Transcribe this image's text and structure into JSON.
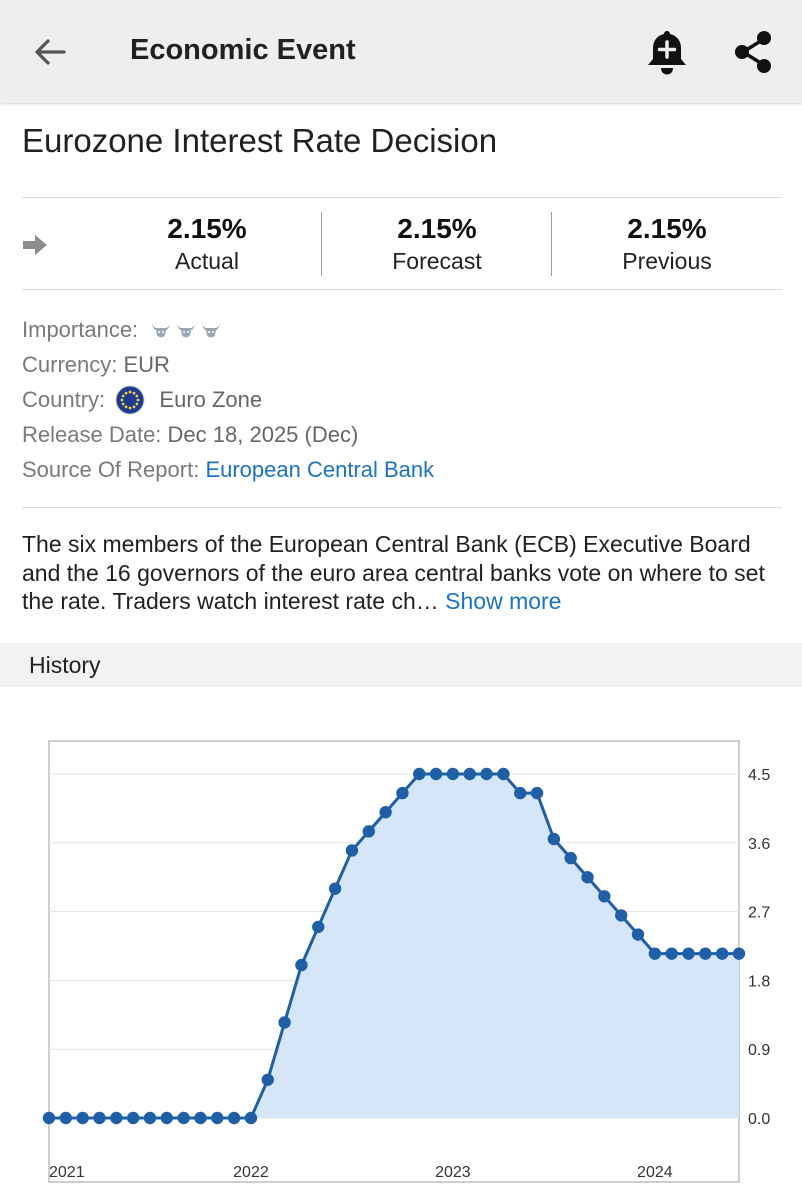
{
  "appbar": {
    "title": "Economic Event",
    "icons": [
      "arrow-back-icon",
      "bell-plus-icon",
      "share-icon"
    ]
  },
  "event": {
    "title": "Eurozone Interest Rate Decision"
  },
  "values": {
    "actual": {
      "value": "2.15%",
      "label": "Actual"
    },
    "forecast": {
      "value": "2.15%",
      "label": "Forecast"
    },
    "previous": {
      "value": "2.15%",
      "label": "Previous"
    }
  },
  "info": {
    "importance_label": "Importance:",
    "importance_level": 3,
    "currency_label": "Currency:",
    "currency_value": "EUR",
    "country_label": "Country:",
    "country_value": "Euro Zone",
    "release_label": "Release Date:",
    "release_value": "Dec 18, 2025 (Dec)",
    "source_label": "Source Of Report:",
    "source_value": "European Central Bank"
  },
  "description": {
    "text": "The six members of the European Central Bank (ECB) Executive Board and the 16 governors of the euro area central banks vote on where to set the rate. Traders watch interest rate ch…",
    "show_more": "Show more"
  },
  "history": {
    "label": "History"
  },
  "colors": {
    "accent": "#1a73c8",
    "series": "#1f5fa8",
    "fill": "#d6e6f9"
  },
  "chart_data": {
    "type": "area",
    "x_ticks": [
      "2021",
      "2022",
      "2023",
      "2024"
    ],
    "y_ticks": [
      "0.0",
      "0.9",
      "1.8",
      "2.7",
      "3.6",
      "4.5"
    ],
    "ylim": [
      0,
      4.5
    ],
    "y_axis_position": "right",
    "grid": true,
    "series": [
      {
        "values": [
          0,
          0,
          0,
          0,
          0,
          0,
          0,
          0,
          0,
          0,
          0,
          0,
          0,
          0.5,
          1.25,
          2.0,
          2.5,
          3.0,
          3.5,
          3.75,
          4.0,
          4.25,
          4.5,
          4.5,
          4.5,
          4.5,
          4.5,
          4.5,
          4.25,
          4.25,
          3.65,
          3.4,
          3.15,
          2.9,
          2.65,
          2.4,
          2.15,
          2.15,
          2.15,
          2.15,
          2.15,
          2.15
        ]
      }
    ]
  }
}
